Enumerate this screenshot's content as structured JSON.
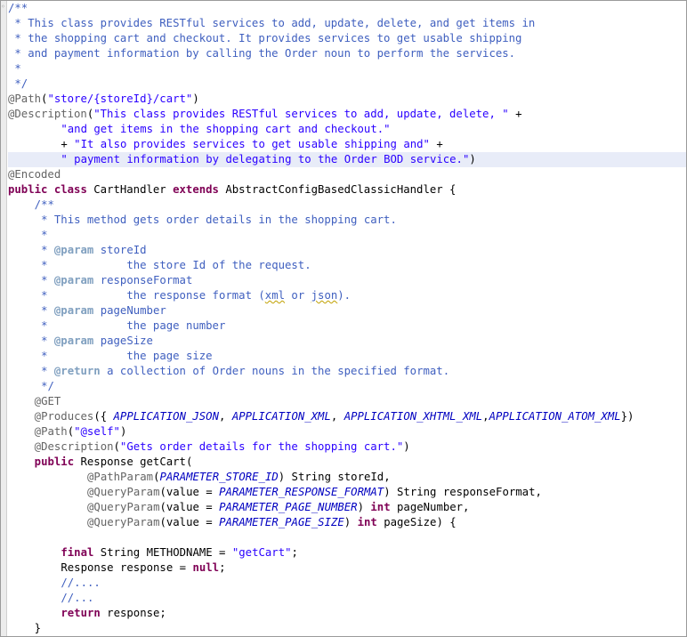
{
  "editor": {
    "current_line": 10,
    "lines": [
      {
        "indent": 0,
        "tokens": [
          {
            "c": "c",
            "t": "/**"
          }
        ]
      },
      {
        "indent": 0,
        "tokens": [
          {
            "c": "c",
            "t": " * This class provides RESTful services to add, update, delete, and get items in"
          }
        ]
      },
      {
        "indent": 0,
        "tokens": [
          {
            "c": "c",
            "t": " * the shopping cart and checkout. It provides services to get usable shipping"
          }
        ]
      },
      {
        "indent": 0,
        "tokens": [
          {
            "c": "c",
            "t": " * and payment information by calling the Order noun to perform the services."
          }
        ]
      },
      {
        "indent": 0,
        "tokens": [
          {
            "c": "c",
            "t": " *"
          }
        ]
      },
      {
        "indent": 0,
        "tokens": [
          {
            "c": "c",
            "t": " */"
          }
        ]
      },
      {
        "indent": 0,
        "tokens": [
          {
            "c": "a",
            "t": "@Path"
          },
          {
            "c": "p",
            "t": "("
          },
          {
            "c": "s",
            "t": "\"store/{storeId}/cart\""
          },
          {
            "c": "p",
            "t": ")"
          }
        ]
      },
      {
        "indent": 0,
        "tokens": [
          {
            "c": "a",
            "t": "@Description"
          },
          {
            "c": "p",
            "t": "("
          },
          {
            "c": "s",
            "t": "\"This class provides RESTful services to add, update, delete, \""
          },
          {
            "c": "p",
            "t": " +"
          }
        ]
      },
      {
        "indent": 8,
        "tokens": [
          {
            "c": "s",
            "t": "\"and get items in the shopping cart and checkout.\""
          }
        ]
      },
      {
        "indent": 8,
        "tokens": [
          {
            "c": "p",
            "t": "+ "
          },
          {
            "c": "s",
            "t": "\"It also provides services to get usable shipping and\""
          },
          {
            "c": "p",
            "t": " +"
          }
        ]
      },
      {
        "indent": 8,
        "tokens": [
          {
            "c": "s",
            "t": "\" payment information by delegating to the Order BOD service.\""
          },
          {
            "c": "p",
            "t": ")"
          }
        ]
      },
      {
        "indent": 0,
        "tokens": [
          {
            "c": "a",
            "t": "@Encoded"
          }
        ]
      },
      {
        "indent": 0,
        "tokens": [
          {
            "c": "k",
            "t": "public"
          },
          {
            "c": "p",
            "t": " "
          },
          {
            "c": "k",
            "t": "class"
          },
          {
            "c": "p",
            "t": " CartHandler "
          },
          {
            "c": "k",
            "t": "extends"
          },
          {
            "c": "p",
            "t": " AbstractConfigBasedClassicHandler {"
          }
        ]
      },
      {
        "indent": 4,
        "tokens": [
          {
            "c": "doc",
            "t": "/**"
          }
        ]
      },
      {
        "indent": 4,
        "tokens": [
          {
            "c": "doc",
            "t": " * This method gets order details in the shopping cart."
          }
        ]
      },
      {
        "indent": 4,
        "tokens": [
          {
            "c": "doc",
            "t": " *"
          }
        ]
      },
      {
        "indent": 4,
        "tokens": [
          {
            "c": "doc",
            "t": " * "
          },
          {
            "c": "tag",
            "t": "@param"
          },
          {
            "c": "doc",
            "t": " storeId"
          }
        ]
      },
      {
        "indent": 4,
        "tokens": [
          {
            "c": "doc",
            "t": " *            the store Id of the request."
          }
        ]
      },
      {
        "indent": 4,
        "tokens": [
          {
            "c": "doc",
            "t": " * "
          },
          {
            "c": "tag",
            "t": "@param"
          },
          {
            "c": "doc",
            "t": " responseFormat"
          }
        ]
      },
      {
        "indent": 4,
        "tokens": [
          {
            "c": "doc",
            "t": " *            the response format ("
          },
          {
            "c": "sq",
            "t": "xml"
          },
          {
            "c": "doc",
            "t": " or "
          },
          {
            "c": "sq",
            "t": "json"
          },
          {
            "c": "doc",
            "t": ")."
          }
        ]
      },
      {
        "indent": 4,
        "tokens": [
          {
            "c": "doc",
            "t": " * "
          },
          {
            "c": "tag",
            "t": "@param"
          },
          {
            "c": "doc",
            "t": " pageNumber"
          }
        ]
      },
      {
        "indent": 4,
        "tokens": [
          {
            "c": "doc",
            "t": " *            the page number"
          }
        ]
      },
      {
        "indent": 4,
        "tokens": [
          {
            "c": "doc",
            "t": " * "
          },
          {
            "c": "tag",
            "t": "@param"
          },
          {
            "c": "doc",
            "t": " pageSize"
          }
        ]
      },
      {
        "indent": 4,
        "tokens": [
          {
            "c": "doc",
            "t": " *            the page size"
          }
        ]
      },
      {
        "indent": 4,
        "tokens": [
          {
            "c": "doc",
            "t": " * "
          },
          {
            "c": "tag",
            "t": "@return"
          },
          {
            "c": "doc",
            "t": " a collection of Order nouns in the specified format."
          }
        ]
      },
      {
        "indent": 4,
        "tokens": [
          {
            "c": "doc",
            "t": " */"
          }
        ]
      },
      {
        "indent": 4,
        "tokens": [
          {
            "c": "a",
            "t": "@GET"
          }
        ]
      },
      {
        "indent": 4,
        "tokens": [
          {
            "c": "a",
            "t": "@Produces"
          },
          {
            "c": "p",
            "t": "({ "
          },
          {
            "c": "f",
            "t": "APPLICATION_JSON"
          },
          {
            "c": "p",
            "t": ", "
          },
          {
            "c": "f",
            "t": "APPLICATION_XML"
          },
          {
            "c": "p",
            "t": ", "
          },
          {
            "c": "f",
            "t": "APPLICATION_XHTML_XML"
          },
          {
            "c": "p",
            "t": ","
          },
          {
            "c": "f",
            "t": "APPLICATION_ATOM_XML"
          },
          {
            "c": "p",
            "t": "})"
          }
        ]
      },
      {
        "indent": 4,
        "tokens": [
          {
            "c": "a",
            "t": "@Path"
          },
          {
            "c": "p",
            "t": "("
          },
          {
            "c": "s",
            "t": "\"@self\""
          },
          {
            "c": "p",
            "t": ")"
          }
        ]
      },
      {
        "indent": 4,
        "tokens": [
          {
            "c": "a",
            "t": "@Description"
          },
          {
            "c": "p",
            "t": "("
          },
          {
            "c": "s",
            "t": "\"Gets order details for the shopping cart.\""
          },
          {
            "c": "p",
            "t": ")"
          }
        ]
      },
      {
        "indent": 4,
        "tokens": [
          {
            "c": "k",
            "t": "public"
          },
          {
            "c": "p",
            "t": " Response getCart("
          }
        ]
      },
      {
        "indent": 12,
        "tokens": [
          {
            "c": "a",
            "t": "@PathParam"
          },
          {
            "c": "p",
            "t": "("
          },
          {
            "c": "f",
            "t": "PARAMETER_STORE_ID"
          },
          {
            "c": "p",
            "t": ") String storeId,"
          }
        ]
      },
      {
        "indent": 12,
        "tokens": [
          {
            "c": "a",
            "t": "@QueryParam"
          },
          {
            "c": "p",
            "t": "(value = "
          },
          {
            "c": "f",
            "t": "PARAMETER_RESPONSE_FORMAT"
          },
          {
            "c": "p",
            "t": ") String responseFormat,"
          }
        ]
      },
      {
        "indent": 12,
        "tokens": [
          {
            "c": "a",
            "t": "@QueryParam"
          },
          {
            "c": "p",
            "t": "(value = "
          },
          {
            "c": "f",
            "t": "PARAMETER_PAGE_NUMBER"
          },
          {
            "c": "p",
            "t": ") "
          },
          {
            "c": "k",
            "t": "int"
          },
          {
            "c": "p",
            "t": " pageNumber,"
          }
        ]
      },
      {
        "indent": 12,
        "tokens": [
          {
            "c": "a",
            "t": "@QueryParam"
          },
          {
            "c": "p",
            "t": "(value = "
          },
          {
            "c": "f",
            "t": "PARAMETER_PAGE_SIZE"
          },
          {
            "c": "p",
            "t": ") "
          },
          {
            "c": "k",
            "t": "int"
          },
          {
            "c": "p",
            "t": " pageSize) {"
          }
        ]
      },
      {
        "indent": 0,
        "tokens": []
      },
      {
        "indent": 8,
        "tokens": [
          {
            "c": "k",
            "t": "final"
          },
          {
            "c": "p",
            "t": " String METHODNAME = "
          },
          {
            "c": "s",
            "t": "\"getCart\""
          },
          {
            "c": "p",
            "t": ";"
          }
        ]
      },
      {
        "indent": 8,
        "tokens": [
          {
            "c": "p",
            "t": "Response response = "
          },
          {
            "c": "k",
            "t": "null"
          },
          {
            "c": "p",
            "t": ";"
          }
        ]
      },
      {
        "indent": 8,
        "tokens": [
          {
            "c": "c",
            "t": "//...."
          }
        ]
      },
      {
        "indent": 8,
        "tokens": [
          {
            "c": "c",
            "t": "//..."
          }
        ]
      },
      {
        "indent": 8,
        "tokens": [
          {
            "c": "k",
            "t": "return"
          },
          {
            "c": "p",
            "t": " response;"
          }
        ]
      },
      {
        "indent": 4,
        "tokens": [
          {
            "c": "p",
            "t": "}"
          }
        ]
      }
    ]
  }
}
